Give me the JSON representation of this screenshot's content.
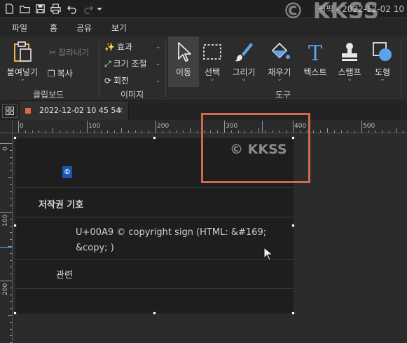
{
  "titlebar": {
    "title": "픽픽 - 2022-12-02 10",
    "watermark": "© KKSS"
  },
  "menu": {
    "tabs": [
      {
        "label": "파일",
        "active": false
      },
      {
        "label": "홈",
        "active": true
      },
      {
        "label": "공유",
        "active": false
      },
      {
        "label": "보기",
        "active": false
      }
    ]
  },
  "ribbon": {
    "clipboard": {
      "paste_label": "붙여넣기",
      "cut_label": "잘라내기",
      "copy_label": "복사",
      "group_label": "클립보드"
    },
    "image": {
      "effect_label": "효과",
      "resize_label": "크기 조절",
      "rotate_label": "회전",
      "group_label": "이미지"
    },
    "tools": {
      "items": [
        {
          "label": "이동",
          "icon": "cursor-arrow-icon"
        },
        {
          "label": "선택",
          "icon": "dashed-select-icon"
        },
        {
          "label": "그리기",
          "icon": "brush-icon"
        },
        {
          "label": "채우기",
          "icon": "paint-bucket-icon"
        },
        {
          "label": "텍스트",
          "icon": "text-t-icon"
        },
        {
          "label": "스탬프",
          "icon": "stamp-icon"
        },
        {
          "label": "도형",
          "icon": "shapes-icon"
        }
      ],
      "group_label": "도구"
    }
  },
  "document_tab": {
    "title": "2022-12-02 10 45 54",
    "close": "×"
  },
  "ruler": {
    "h_labels": [
      "0",
      "100",
      "200",
      "300",
      "400",
      "500"
    ],
    "v_labels": [
      "0",
      "100",
      "200"
    ]
  },
  "content": {
    "symbol": "©",
    "section_title": "저작권 기호",
    "description": "U+00A9 © copyright sign (HTML: &#169; &copy; )",
    "related": "관련",
    "watermark": "© KKSS"
  },
  "colors": {
    "accent_selection": "#cf6a4a",
    "symbol_badge": "#1a55b8",
    "tab_dot": "#e0664a"
  }
}
